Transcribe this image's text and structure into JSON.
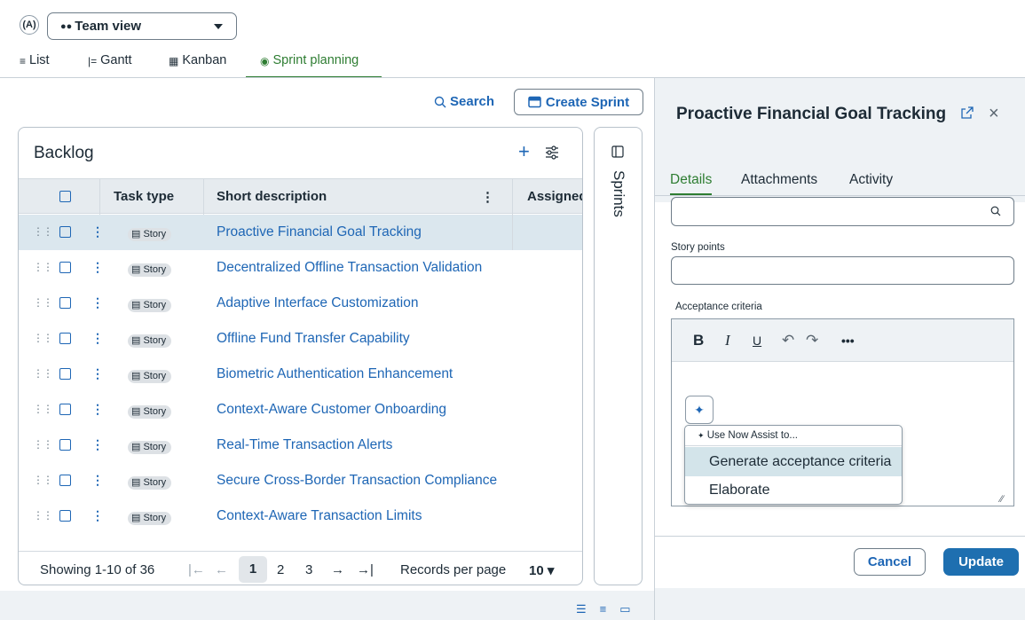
{
  "header": {
    "view_icon_text": "(A)",
    "view_select": "Team view",
    "view_tabs": [
      {
        "label": "List",
        "icon": "list-icon"
      },
      {
        "label": "Gantt",
        "icon": "gantt-icon"
      },
      {
        "label": "Kanban",
        "icon": "kanban-icon"
      },
      {
        "label": "Sprint planning",
        "icon": "sprint-icon",
        "active": true
      }
    ]
  },
  "toolbar": {
    "search_label": "Search",
    "create_sprint_label": "Create Sprint"
  },
  "backlog": {
    "title": "Backlog",
    "columns": [
      "Task type",
      "Short description",
      "Assigned"
    ],
    "rows": [
      {
        "type": "Story",
        "desc": "Proactive Financial Goal Tracking",
        "selected": true
      },
      {
        "type": "Story",
        "desc": "Decentralized Offline Transaction Validation"
      },
      {
        "type": "Story",
        "desc": "Adaptive Interface Customization"
      },
      {
        "type": "Story",
        "desc": "Offline Fund Transfer Capability"
      },
      {
        "type": "Story",
        "desc": "Biometric Authentication Enhancement"
      },
      {
        "type": "Story",
        "desc": "Context-Aware Customer Onboarding"
      },
      {
        "type": "Story",
        "desc": "Real-Time Transaction Alerts"
      },
      {
        "type": "Story",
        "desc": "Secure Cross-Border Transaction Compliance"
      },
      {
        "type": "Story",
        "desc": "Context-Aware Transaction Limits"
      }
    ],
    "pager": {
      "showing": "Showing 1-10 of 36",
      "pages": [
        "1",
        "2",
        "3"
      ],
      "current_page": "1",
      "records_label": "Records per page",
      "records_value": "10"
    }
  },
  "sprints_label": "Sprints",
  "detail": {
    "title": "Proactive Financial Goal Tracking",
    "tabs": [
      "Details",
      "Attachments",
      "Activity"
    ],
    "story_points_label": "Story points",
    "acceptance_label": "Acceptance criteria",
    "editor_tools": [
      "B",
      "I",
      "U",
      "↶",
      "↷",
      "•••"
    ],
    "assist": {
      "heading": "Use Now Assist to...",
      "items": [
        "Generate acceptance criteria",
        "Elaborate"
      ]
    },
    "cancel_label": "Cancel",
    "update_label": "Update"
  },
  "colors": {
    "link": "#1e66b5",
    "active_tab": "#2e7d32",
    "selected_row": "#dbe7ee",
    "primary_button": "#1e6fb0"
  }
}
